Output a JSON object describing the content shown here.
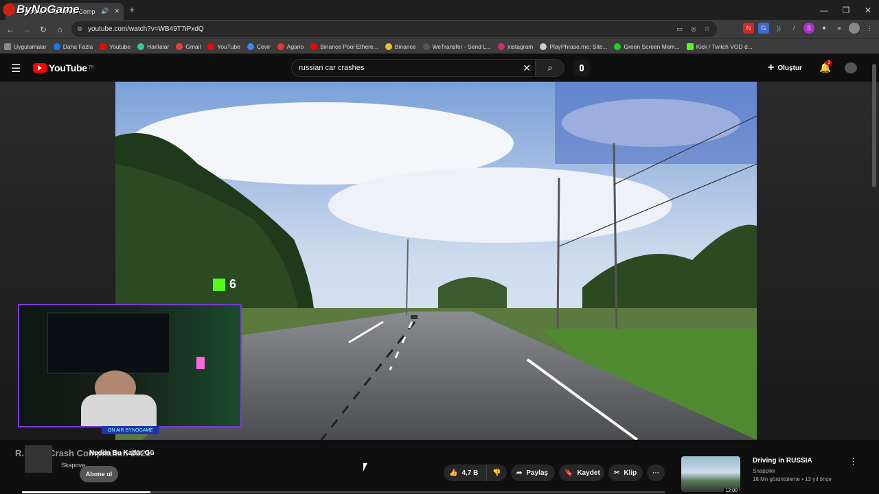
{
  "browser": {
    "tab_title": "Russian Car Crash Comp",
    "overlay_brand": "ByNoGame",
    "url": "youtube.com/watch?v=WB49T7iPxdQ",
    "bookmarks": [
      "Uygulamalar",
      "Daha Fazla",
      "Youtube",
      "Haritalar",
      "Gmail",
      "YouTube",
      "Çevir",
      "Agario",
      "Binance Pool Ethere...",
      "Binance",
      "WeTransfer - Send L...",
      "instagram",
      "PlayPhrase.me: Site...",
      "Green Screen Mem...",
      "Kick / Twitch VOD d..."
    ]
  },
  "youtube": {
    "logo_text": "YouTube",
    "region": "TR",
    "search_value": "russian car crashes",
    "create_label": "Oluştur",
    "notification_count": "3"
  },
  "overlay": {
    "kick_count": "6",
    "cam_label": "ON AIR BYNOGAME"
  },
  "video_info": {
    "title_partial": "R... Car Crash Compilation 2021",
    "chat_message": "Neden Bu Kadar Gü",
    "channel_name": "Skapova",
    "subscribe_label": "Abone ol",
    "likes": "4,7 B",
    "share_label": "Paylaş",
    "save_label": "Kaydet",
    "clip_label": "Klip"
  },
  "recommended": {
    "title": "Driving in RUSSIA",
    "channel": "Snappikk",
    "meta": "18 Mn görüntüleme • 13 yıl önce",
    "duration": "12:00"
  },
  "progress": {
    "played_fraction": 0.2
  },
  "colors": {
    "accent": "#ff0000",
    "cam_border": "#7a3bd6"
  }
}
